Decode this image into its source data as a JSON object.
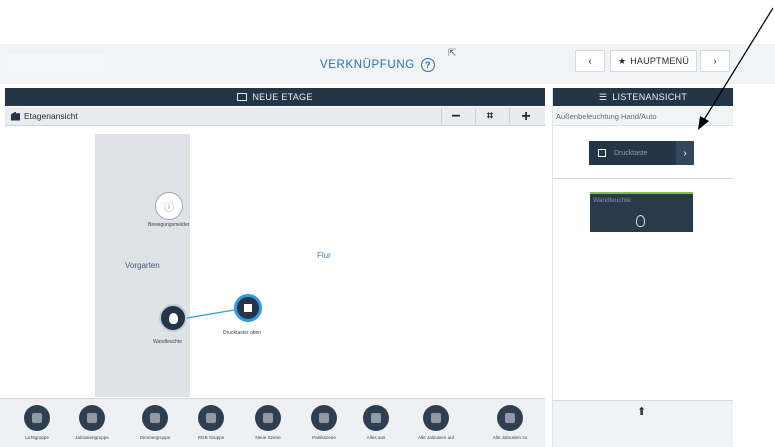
{
  "header": {
    "title": "VERKNÜPFUNG",
    "help_icon": "?",
    "nav_prev": "‹",
    "main_menu": "HAUPTMENÜ",
    "main_menu_icon": "★",
    "nav_next": "›"
  },
  "left_panel": {
    "header_title": "NEUE ETAGE",
    "toolbar_label": "Etagenansicht",
    "zoom_out": "−",
    "fit": "⌗",
    "zoom_in": "+"
  },
  "canvas": {
    "rooms": [
      "Vorgarten",
      "Flur"
    ],
    "devices": {
      "motion": "Bewegungsmelder",
      "lamp": "Wandleuchte",
      "taster": "Drucktaster oben"
    }
  },
  "palette": [
    "Lichtgruppe",
    "Jalousiengruppe",
    "Dimmergruppe",
    "RGB Gruppe",
    "Neue Szene",
    "Panikszene",
    "Alles aus",
    "Alle Jalousien auf",
    "Alle Jalousien zu"
  ],
  "right_panel": {
    "header_title": "LISTENANSICHT",
    "subheader": "Außenbeleuchtung Hand/Auto",
    "button_label": "Drucktaste",
    "button_next": "›",
    "card_label": "Wandleuchte"
  },
  "colors": {
    "navy": "#243548",
    "accent_blue": "#2e9be0",
    "title_blue": "#2a6fb0",
    "card_green": "#7ec243"
  }
}
